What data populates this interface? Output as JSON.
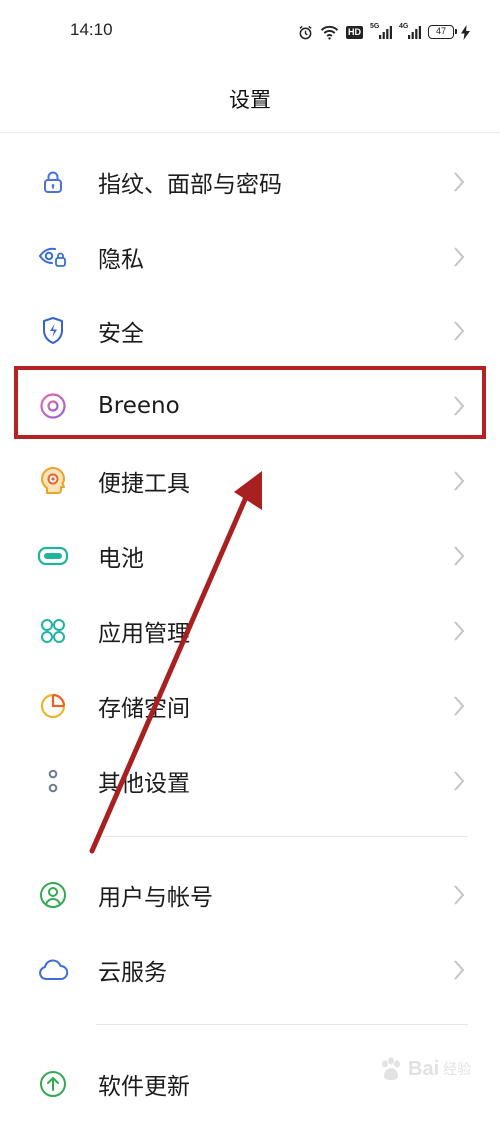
{
  "status_bar": {
    "time": "14:10",
    "icons": [
      "alarm-icon",
      "wifi-icon",
      "hd-icon",
      "signal-5g-icon",
      "signal-4g-icon",
      "battery-icon",
      "charging-icon"
    ],
    "hd_label": "HD",
    "sim1_tag": "5G",
    "sim2_tag": "4G",
    "battery_level": "47"
  },
  "header": {
    "title": "设置"
  },
  "groups": [
    {
      "items": [
        {
          "label": "指纹、面部与密码",
          "icon": "lock-icon",
          "color": "#4a72d9"
        },
        {
          "label": "隐私",
          "icon": "privacy-eye-icon",
          "color": "#3a6ed6"
        },
        {
          "label": "安全",
          "icon": "shield-icon",
          "color": "#3a62cf"
        },
        {
          "label": "Breeno",
          "icon": "breeno-icon",
          "color": "#c65fc2"
        },
        {
          "label": "便捷工具",
          "icon": "shortcut-tools-icon",
          "color": "#e8a32c"
        },
        {
          "label": "电池",
          "icon": "battery-setting-icon",
          "color": "#20b59a"
        },
        {
          "label": "应用管理",
          "icon": "app-management-icon",
          "color": "#1fb3a2"
        },
        {
          "label": "存储空间",
          "icon": "storage-pie-icon",
          "color": "#f0a428"
        },
        {
          "label": "其他设置",
          "icon": "more-dots-icon",
          "color": "#6c7a90"
        }
      ]
    },
    {
      "items": [
        {
          "label": "用户与帐号",
          "icon": "user-account-icon",
          "color": "#34a853"
        },
        {
          "label": "云服务",
          "icon": "cloud-icon",
          "color": "#3f6fd6"
        }
      ]
    },
    {
      "items": [
        {
          "label": "软件更新",
          "icon": "update-arrow-icon",
          "color": "#34a853"
        }
      ]
    }
  ],
  "annotation": {
    "highlight_color": "#b42323",
    "highlighted_item": "Breeno"
  },
  "watermark": {
    "brand": "Bai",
    "suffix": "经验"
  }
}
